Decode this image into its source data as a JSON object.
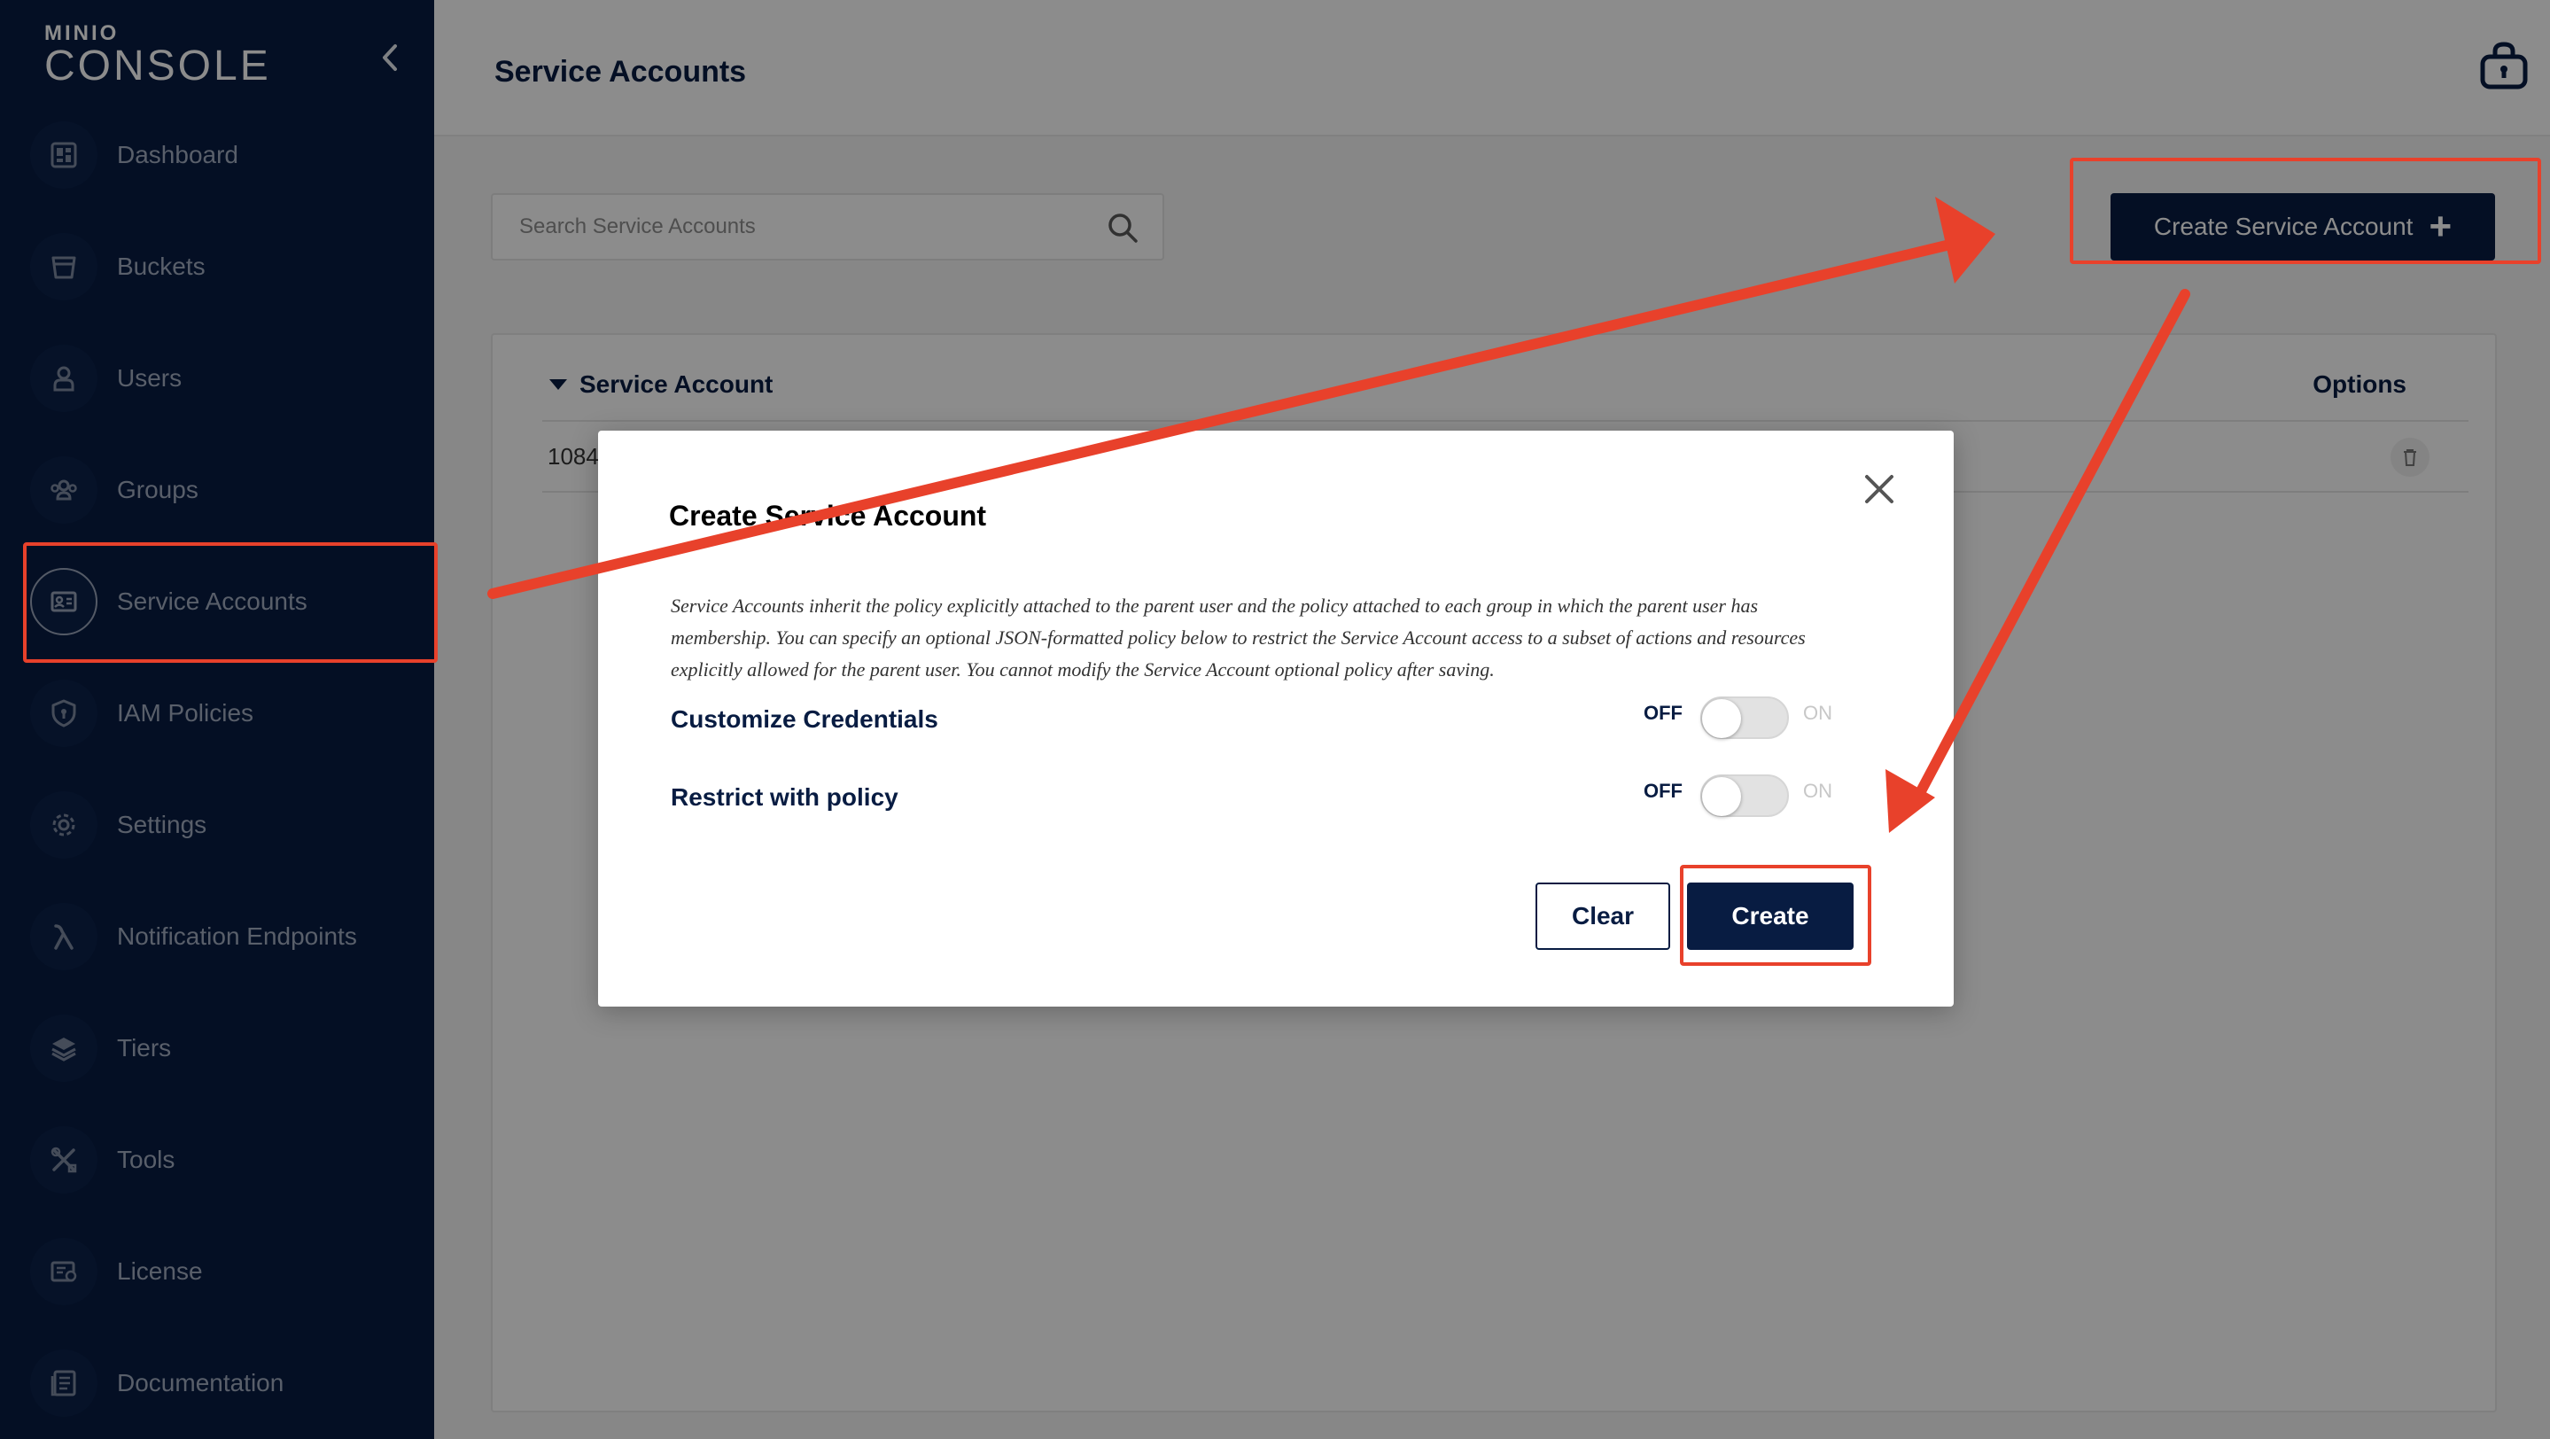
{
  "sidebar": {
    "brand": "MINIO",
    "product": "CONSOLE",
    "items": [
      {
        "label": "Dashboard",
        "icon": "dashboard-icon"
      },
      {
        "label": "Buckets",
        "icon": "bucket-icon"
      },
      {
        "label": "Users",
        "icon": "user-icon"
      },
      {
        "label": "Groups",
        "icon": "groups-icon"
      },
      {
        "label": "Service Accounts",
        "icon": "service-account-icon",
        "active": true
      },
      {
        "label": "IAM Policies",
        "icon": "shield-icon"
      },
      {
        "label": "Settings",
        "icon": "gear-icon"
      },
      {
        "label": "Notification Endpoints",
        "icon": "lambda-icon"
      },
      {
        "label": "Tiers",
        "icon": "layers-icon"
      },
      {
        "label": "Tools",
        "icon": "tools-icon"
      },
      {
        "label": "License",
        "icon": "license-icon"
      },
      {
        "label": "Documentation",
        "icon": "document-icon"
      }
    ]
  },
  "header": {
    "title": "Service Accounts"
  },
  "toolbar": {
    "search_placeholder": "Search Service Accounts",
    "create_label": "Create Service Account"
  },
  "table": {
    "column_header": "Service Account",
    "options_header": "Options",
    "rows": [
      "1084N"
    ]
  },
  "modal": {
    "title": "Create Service Account",
    "description": "Service Accounts inherit the policy explicitly attached to the parent user and the policy attached to each group in which the parent user has membership. You can specify an optional JSON-formatted policy below to restrict the Service Account access to a subset of actions and resources explicitly allowed for the parent user. You cannot modify the Service Account optional policy after saving.",
    "settings": [
      {
        "label": "Customize Credentials",
        "off_label": "OFF",
        "on_label": "ON",
        "value": "OFF"
      },
      {
        "label": "Restrict with policy",
        "off_label": "OFF",
        "on_label": "ON",
        "value": "OFF"
      }
    ],
    "clear_label": "Clear",
    "create_label": "Create"
  },
  "colors": {
    "sidebar_bg": "#081c42",
    "accent": "#081c42",
    "annotation": "#e8412b"
  }
}
